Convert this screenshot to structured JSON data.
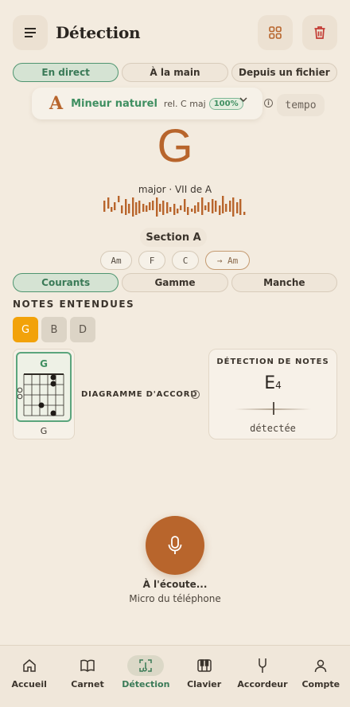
{
  "header": {
    "title": "Détection"
  },
  "modes": [
    {
      "label": "En direct",
      "active": true
    },
    {
      "label": "À la main",
      "active": false
    },
    {
      "label": "Depuis un fichier",
      "active": false
    }
  ],
  "key": {
    "note": "A",
    "mode": "Mineur naturel",
    "relative": "rel. C maj",
    "confidence": "100%"
  },
  "tempo": "tempo",
  "chord": {
    "name": "G",
    "description": "major · VII de A"
  },
  "section": "Section A",
  "progression": [
    "Am",
    "F",
    "C",
    "→ Am"
  ],
  "views": [
    {
      "label": "Courants",
      "active": true
    },
    {
      "label": "Gamme",
      "active": false
    },
    {
      "label": "Manche",
      "active": false
    }
  ],
  "heard": {
    "label": "NOTES ENTENDUES",
    "notes": [
      "G",
      "B",
      "D"
    ],
    "active_index": 0
  },
  "diagram": {
    "name": "G",
    "label": "G",
    "title": "DIAGRAMME D'ACCORD",
    "info": "i"
  },
  "detection": {
    "title": "DÉTECTION DE NOTES",
    "note": "E",
    "octave": "4",
    "status": "détectée"
  },
  "listening": {
    "status": "À l'écoute...",
    "source": "Micro du téléphone"
  },
  "nav": [
    {
      "label": "Accueil",
      "icon": "home-icon",
      "active": false
    },
    {
      "label": "Carnet",
      "icon": "book-icon",
      "active": false
    },
    {
      "label": "Détection",
      "icon": "detection-icon",
      "active": true
    },
    {
      "label": "Clavier",
      "icon": "piano-icon",
      "active": false
    },
    {
      "label": "Accordeur",
      "icon": "tuning-fork-icon",
      "active": false
    },
    {
      "label": "Compte",
      "icon": "user-icon",
      "active": false
    }
  ],
  "colors": {
    "accent": "#b8652c",
    "green": "#3f8f61",
    "background": "#f3ebdf",
    "note_active": "#f2a20a"
  }
}
